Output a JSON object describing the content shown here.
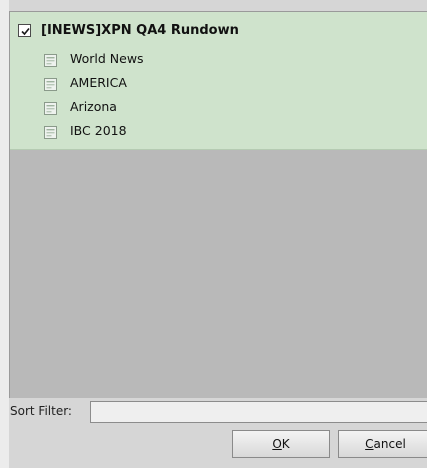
{
  "tree": {
    "root": {
      "label": "[INEWS]XPN QA4 Rundown",
      "checked": true
    },
    "items": [
      {
        "label": "World News",
        "icon": "document-icon"
      },
      {
        "label": "AMERICA",
        "icon": "document-icon"
      },
      {
        "label": "Arizona",
        "icon": "document-icon"
      },
      {
        "label": "IBC 2018",
        "icon": "document-icon"
      }
    ]
  },
  "sort_filter": {
    "label": "Sort Filter:",
    "value": "",
    "placeholder": ""
  },
  "buttons": {
    "ok": {
      "underline": "O",
      "rest": "K"
    },
    "cancel": {
      "underline": "C",
      "rest": "ancel"
    }
  },
  "colors": {
    "selection_green": "#cfe3cc",
    "panel_gray": "#b9b9b9",
    "dialog_bg": "#d6d6d6"
  }
}
